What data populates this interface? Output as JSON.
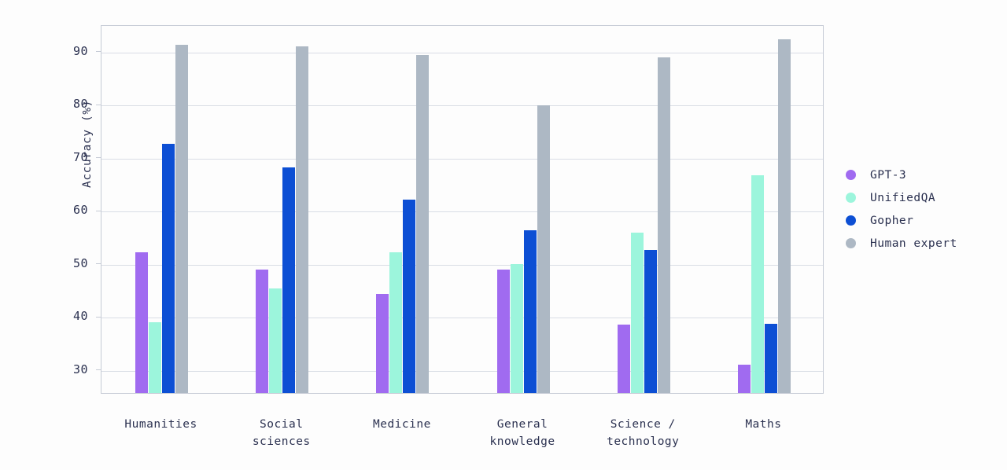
{
  "chart_data": {
    "type": "bar",
    "title": "",
    "xlabel": "",
    "ylabel": "Accuracy (%)",
    "ylim": [
      25.5,
      95
    ],
    "yticks": [
      30,
      40,
      50,
      60,
      70,
      80,
      90
    ],
    "ytick_labels": [
      "30",
      "40",
      "50",
      "60",
      "70",
      "80",
      "90"
    ],
    "grid": true,
    "legend_position": "right",
    "categories": [
      "Humanities",
      "Social\nsciences",
      "Medicine",
      "General\nknowledge",
      "Science /\ntechnology",
      "Maths"
    ],
    "series": [
      {
        "name": "GPT-3",
        "color": "#a06bf0",
        "values": [
          52.3,
          49.0,
          44.5,
          49.0,
          38.7,
          31.1
        ]
      },
      {
        "name": "UnifiedQA",
        "color": "#9cf5dc",
        "values": [
          39.2,
          45.5,
          52.3,
          50.1,
          56.1,
          66.8
        ]
      },
      {
        "name": "Gopher",
        "color": "#0d4fd4",
        "values": [
          72.8,
          68.3,
          62.2,
          56.5,
          52.7,
          38.8
        ]
      },
      {
        "name": "Human expert",
        "color": "#adb8c4",
        "values": [
          91.5,
          91.1,
          89.5,
          80.0,
          89.1,
          92.5
        ]
      }
    ]
  },
  "legend": {
    "items": [
      {
        "label": "GPT-3",
        "color": "#a06bf0"
      },
      {
        "label": "UnifiedQA",
        "color": "#9cf5dc"
      },
      {
        "label": "Gopher",
        "color": "#0d4fd4"
      },
      {
        "label": "Human expert",
        "color": "#adb8c4"
      }
    ]
  },
  "colors": {
    "background": "#fdfdfd",
    "text": "#2b3150",
    "grid": "#d9dde5",
    "frame": "#c6cbd6"
  }
}
